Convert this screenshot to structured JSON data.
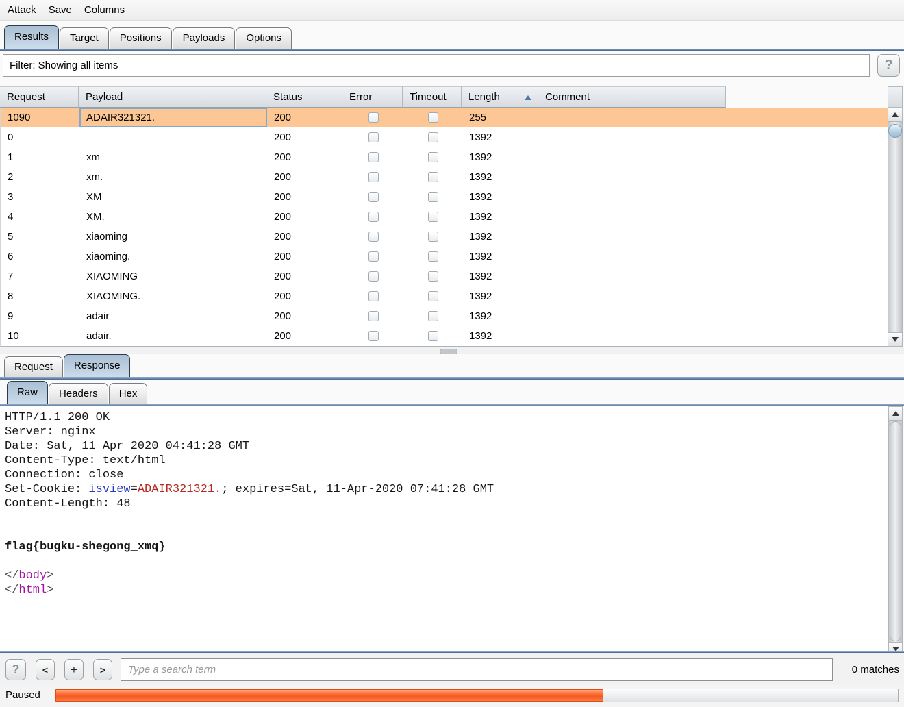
{
  "menu": {
    "items": [
      "Attack",
      "Save",
      "Columns"
    ]
  },
  "tabs": {
    "main": {
      "items": [
        "Results",
        "Target",
        "Positions",
        "Payloads",
        "Options"
      ],
      "selected": "Results"
    },
    "message": {
      "items": [
        "Request",
        "Response"
      ],
      "selected": "Response"
    },
    "view": {
      "items": [
        "Raw",
        "Headers",
        "Hex"
      ],
      "selected": "Raw"
    }
  },
  "filter": {
    "text": "Filter: Showing all items",
    "help_label": "?"
  },
  "table": {
    "columns": [
      "Request",
      "Payload",
      "Status",
      "Error",
      "Timeout",
      "Length",
      "Comment"
    ],
    "sort": {
      "column": "Length",
      "direction": "asc"
    },
    "rows": [
      {
        "request": "1090",
        "payload": "ADAIR321321.",
        "status": "200",
        "error": false,
        "timeout": false,
        "length": "255",
        "comment": "",
        "selected": true
      },
      {
        "request": "0",
        "payload": "",
        "status": "200",
        "error": false,
        "timeout": false,
        "length": "1392",
        "comment": ""
      },
      {
        "request": "1",
        "payload": "xm",
        "status": "200",
        "error": false,
        "timeout": false,
        "length": "1392",
        "comment": ""
      },
      {
        "request": "2",
        "payload": "xm.",
        "status": "200",
        "error": false,
        "timeout": false,
        "length": "1392",
        "comment": ""
      },
      {
        "request": "3",
        "payload": "XM",
        "status": "200",
        "error": false,
        "timeout": false,
        "length": "1392",
        "comment": ""
      },
      {
        "request": "4",
        "payload": "XM.",
        "status": "200",
        "error": false,
        "timeout": false,
        "length": "1392",
        "comment": ""
      },
      {
        "request": "5",
        "payload": "xiaoming",
        "status": "200",
        "error": false,
        "timeout": false,
        "length": "1392",
        "comment": ""
      },
      {
        "request": "6",
        "payload": "xiaoming.",
        "status": "200",
        "error": false,
        "timeout": false,
        "length": "1392",
        "comment": ""
      },
      {
        "request": "7",
        "payload": "XIAOMING",
        "status": "200",
        "error": false,
        "timeout": false,
        "length": "1392",
        "comment": ""
      },
      {
        "request": "8",
        "payload": "XIAOMING.",
        "status": "200",
        "error": false,
        "timeout": false,
        "length": "1392",
        "comment": ""
      },
      {
        "request": "9",
        "payload": "adair",
        "status": "200",
        "error": false,
        "timeout": false,
        "length": "1392",
        "comment": ""
      },
      {
        "request": "10",
        "payload": "adair.",
        "status": "200",
        "error": false,
        "timeout": false,
        "length": "1392",
        "comment": ""
      }
    ]
  },
  "response": {
    "lines": [
      [
        {
          "t": "HTTP/1.1 200 OK"
        }
      ],
      [
        {
          "t": "Server: nginx"
        }
      ],
      [
        {
          "t": "Date: Sat, 11 Apr 2020 04:41:28 GMT"
        }
      ],
      [
        {
          "t": "Content-Type: text/html"
        }
      ],
      [
        {
          "t": "Connection: close"
        }
      ],
      [
        {
          "t": "Set-Cookie: "
        },
        {
          "t": "isview",
          "c": "blue"
        },
        {
          "t": "="
        },
        {
          "t": "ADAIR321321.",
          "c": "red"
        },
        {
          "t": "; expires=Sat, 11-Apr-2020 07:41:28 GMT"
        }
      ],
      [
        {
          "t": "Content-Length: 48"
        }
      ],
      [],
      [],
      [
        {
          "t": "flag{bugku-shegong_xmq}",
          "c": "bold"
        }
      ],
      [],
      [
        {
          "t": "</",
          "c": "gray"
        },
        {
          "t": "body",
          "c": "tag"
        },
        {
          "t": ">",
          "c": "gray"
        }
      ],
      [
        {
          "t": "</",
          "c": "gray"
        },
        {
          "t": "html",
          "c": "tag"
        },
        {
          "t": ">",
          "c": "gray"
        }
      ]
    ]
  },
  "search": {
    "help_label": "?",
    "prev_label": "<",
    "add_label": "+",
    "next_label": ">",
    "placeholder": "Type a search term",
    "matches_label": "0 matches"
  },
  "status": {
    "label": "Paused",
    "progress_percent": 65
  }
}
